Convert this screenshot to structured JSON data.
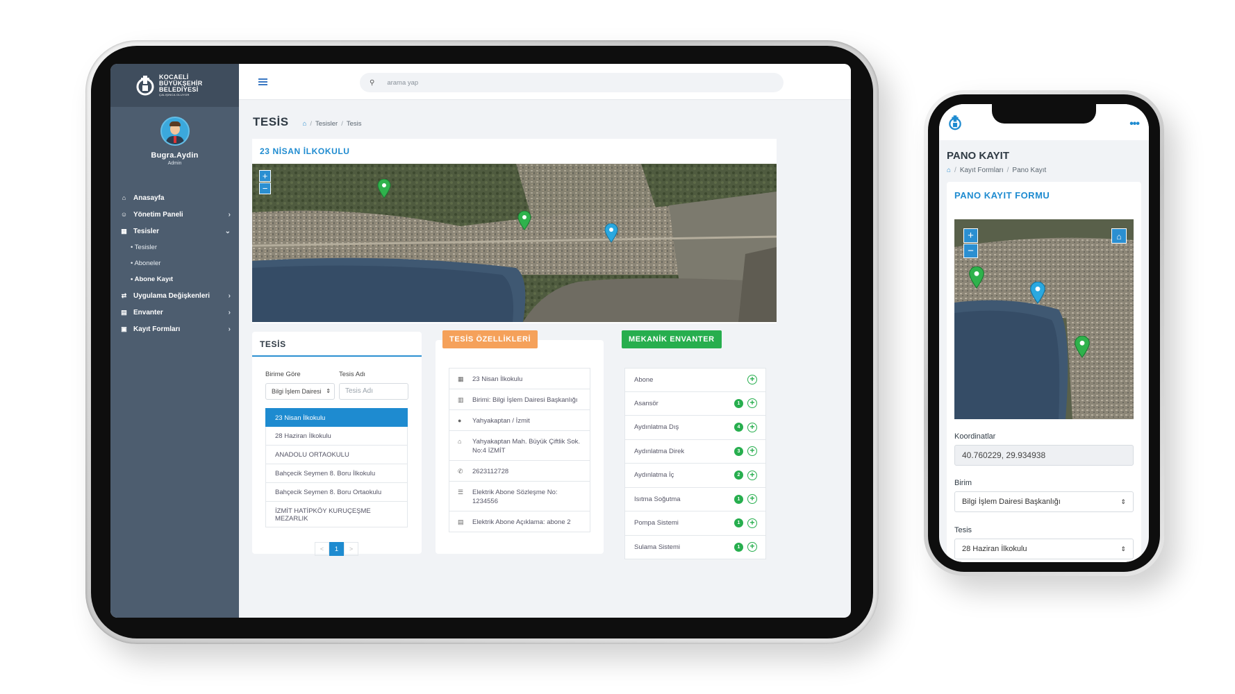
{
  "brand": {
    "logo_line1": "KOCAELİ",
    "logo_line2": "BÜYÜKŞEHİR",
    "logo_line3": "BELEDİYESİ",
    "logo_tagline": "ÇALIŞINCA OLUYOR"
  },
  "user": {
    "name": "Bugra.Aydin",
    "role": "Admin"
  },
  "sidebar": {
    "items": [
      {
        "label": "Anasayfa",
        "icon": "home-icon"
      },
      {
        "label": "Yönetim Paneli",
        "icon": "users-icon"
      },
      {
        "label": "Tesisler",
        "icon": "building-icon"
      },
      {
        "label": "Uygulama Değişkenleri",
        "icon": "swap-icon"
      },
      {
        "label": "Envanter",
        "icon": "inventory-icon"
      },
      {
        "label": "Kayıt Formları",
        "icon": "form-icon"
      }
    ],
    "subitems": [
      "• Tesisler",
      "• Aboneler",
      "• Abone Kayıt"
    ]
  },
  "search": {
    "placeholder": "arama yap"
  },
  "page": {
    "title": "TESİS",
    "breadcrumb": [
      "Tesisler",
      "Tesis"
    ]
  },
  "map_card": {
    "title": "23 NİSAN İLKOKULU"
  },
  "tesis_card": {
    "title": "TESİS",
    "filter_label_1": "Birime Göre",
    "filter_label_2": "Tesis Adı",
    "select_value": "Bilgi İşlem Dairesi",
    "input_placeholder": "Tesis Adı",
    "list": [
      "23 Nisan İlkokulu",
      "28 Haziran İlkokulu",
      "ANADOLU ORTAOKULU",
      "Bahçecik Seymen 8. Boru İlkokulu",
      "Bahçecik Seymen 8. Boru Ortaokulu",
      "İZMİT HATİPKÖY KURUÇEŞME MEZARLIK"
    ],
    "pager": {
      "prev": "<",
      "page": "1",
      "next": ">"
    }
  },
  "ozellik_card": {
    "title": "TESİS ÖZELLİKLERİ",
    "color": "#f5a15a",
    "items": [
      {
        "icon": "building-icon",
        "text": "23 Nisan İlkokulu"
      },
      {
        "icon": "office-icon",
        "text": "Birimi: Bilgi İşlem Dairesi Başkanlığı"
      },
      {
        "icon": "pin-icon",
        "text": "Yahyakaptan / İzmit"
      },
      {
        "icon": "house-icon",
        "text": "Yahyakaptan Mah. Büyük Çiftlik Sok. No:4 İZMİT"
      },
      {
        "icon": "phone-icon",
        "text": "2623112728"
      },
      {
        "icon": "list-icon",
        "text": "Elektrik Abone Sözleşme No: 1234556"
      },
      {
        "icon": "document-icon",
        "text": "Elektrik Abone Açıklama: abone 2"
      }
    ]
  },
  "mekanik_card": {
    "title": "MEKANİK ENVANTER",
    "color": "#27ae4e",
    "items": [
      {
        "label": "Abone",
        "count": ""
      },
      {
        "label": "Asansör",
        "count": "1"
      },
      {
        "label": "Aydınlatma Dış",
        "count": "4"
      },
      {
        "label": "Aydınlatma Direk",
        "count": "3"
      },
      {
        "label": "Aydınlatma İç",
        "count": "2"
      },
      {
        "label": "Isıtma Soğutma",
        "count": "1"
      },
      {
        "label": "Pompa Sistemi",
        "count": "1"
      },
      {
        "label": "Sulama Sistemi",
        "count": "1"
      }
    ]
  },
  "phone": {
    "menu_icon": "more-dots-icon",
    "title": "PANO KAYIT",
    "breadcrumb": [
      "Kayıt Formları",
      "Pano Kayıt"
    ],
    "card_title": "PANO KAYIT FORMU",
    "coord_label": "Koordinatlar",
    "coord_value": "40.760229, 29.934938",
    "birim_label": "Birim",
    "birim_value": "Bilgi İşlem Dairesi Başkanlığı",
    "tesis_label": "Tesis",
    "tesis_value": "28 Haziran İlkokulu"
  },
  "colors": {
    "accent": "#1e8bd0",
    "sidebar": "#4d5d6f",
    "marker_green": "#2fb24c",
    "marker_blue": "#2aa8e0"
  }
}
